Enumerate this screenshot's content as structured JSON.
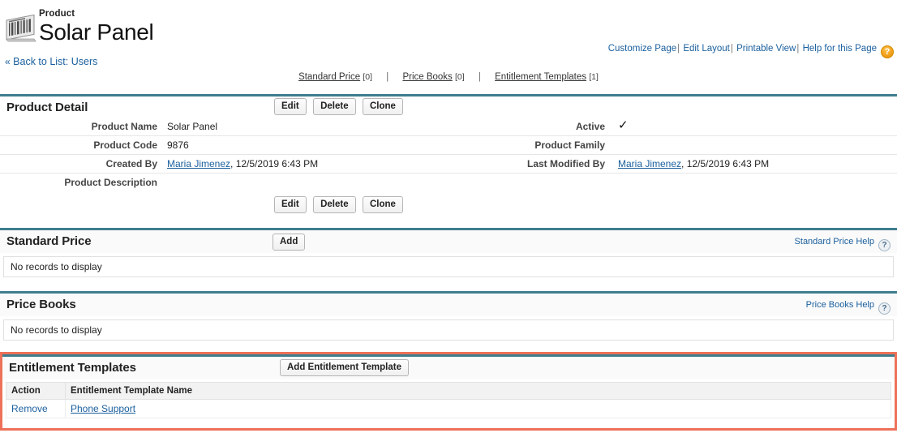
{
  "header": {
    "eyebrow": "Product",
    "title": "Solar Panel",
    "icon": "barcode-product-icon"
  },
  "top_links": {
    "customize_page": "Customize Page",
    "edit_layout": "Edit Layout",
    "printable_view": "Printable View",
    "help_for_this_page": "Help for this Page",
    "separator": "|",
    "help_icon_glyph": "?",
    "help_icon_color": "#f5a623"
  },
  "back_link": {
    "chevron": "«",
    "label": "Back to List: Users"
  },
  "section_nav": {
    "separator": "|",
    "items": [
      {
        "label": "Standard Price",
        "count": "[0]"
      },
      {
        "label": "Price Books",
        "count": "[0]"
      },
      {
        "label": "Entitlement Templates",
        "count": "[1]"
      }
    ]
  },
  "product_detail": {
    "title": "Product Detail",
    "buttons": {
      "edit": "Edit",
      "delete": "Delete",
      "clone": "Clone"
    },
    "rows": [
      {
        "label_left": "Product Name",
        "value_left": "Solar Panel",
        "label_right": "Active",
        "value_right": "✓"
      },
      {
        "label_left": "Product Code",
        "value_left": "9876",
        "label_right": "Product Family",
        "value_right": ""
      },
      {
        "label_left": "Created By",
        "value_left_link": "Maria Jimenez",
        "value_left_rest": ", 12/5/2019 6:43 PM",
        "label_right": "Last Modified By",
        "value_right_link": "Maria Jimenez",
        "value_right_rest": ", 12/5/2019 6:43 PM"
      },
      {
        "label_left": "Product Description",
        "value_left": "",
        "label_right": "",
        "value_right": ""
      }
    ]
  },
  "standard_price": {
    "title": "Standard Price",
    "add_button": "Add",
    "help_link": "Standard Price Help",
    "help_icon_glyph": "?",
    "empty_message": "No records to display"
  },
  "price_books": {
    "title": "Price Books",
    "help_link": "Price Books Help",
    "help_icon_glyph": "?",
    "empty_message": "No records to display"
  },
  "entitlement_templates": {
    "title": "Entitlement Templates",
    "add_button": "Add Entitlement Template",
    "highlight_color": "#ed7159",
    "columns": [
      "Action",
      "Entitlement Template Name"
    ],
    "rows": [
      {
        "action": "Remove",
        "name": "Phone Support"
      }
    ]
  },
  "theme": {
    "teal_bar": "#3f7d8e",
    "link_blue": "#1a5f9e"
  }
}
